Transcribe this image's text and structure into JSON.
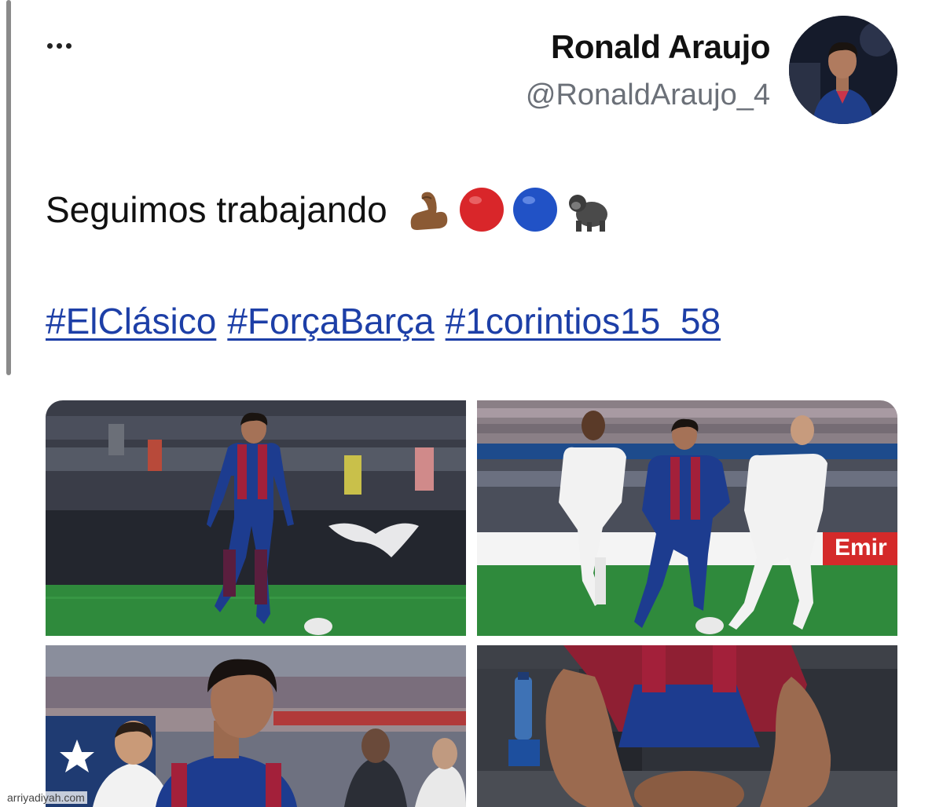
{
  "author": {
    "name": "Ronald Araujo",
    "handle": "@RonaldAraujo_4"
  },
  "tweet": {
    "text": "Seguimos trabajando",
    "emojis": [
      "flexed-biceps",
      "red-circle",
      "blue-circle",
      "gorilla"
    ],
    "hashtags": [
      "#ElClásico",
      "#ForçaBarça",
      "#1corintios15_58"
    ]
  },
  "media": {
    "photos": [
      {
        "description_icon": "photo-player-dribbling"
      },
      {
        "description_icon": "photo-player-vs-opponents"
      },
      {
        "description_icon": "photo-player-portrait"
      },
      {
        "description_icon": "photo-player-kneeling"
      }
    ],
    "ad_board_text": "Emir"
  },
  "watermark": "arriyadiyah.com",
  "colors": {
    "link": "#1d3fa7",
    "handle": "#6b7078",
    "barca_blue": "#1d3c8f",
    "barca_red": "#a3203a",
    "pitch": "#2f8a3c"
  }
}
